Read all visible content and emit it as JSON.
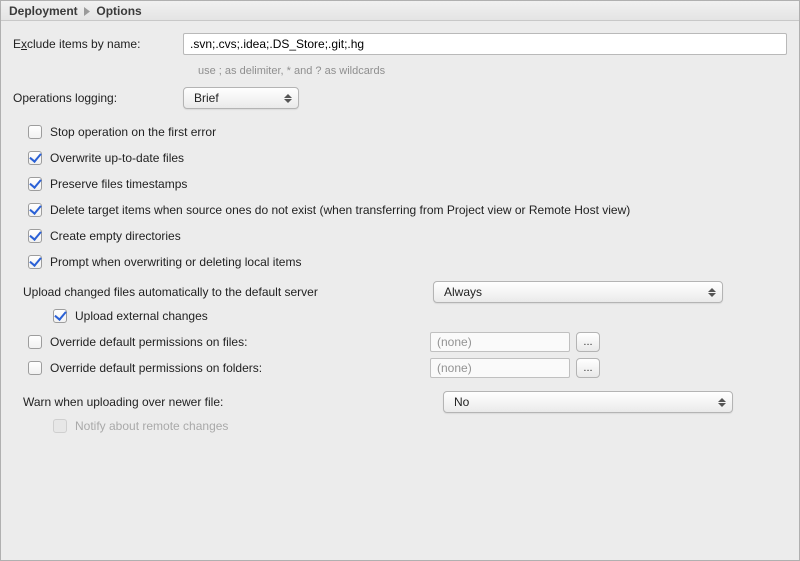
{
  "breadcrumb": {
    "root": "Deployment",
    "leaf": "Options"
  },
  "exclude": {
    "label_pre": "E",
    "label_ul": "x",
    "label_post": "clude items by name:",
    "value": ".svn;.cvs;.idea;.DS_Store;.git;.hg",
    "hint": "use ; as delimiter, * and ? as wildcards"
  },
  "logging": {
    "label": "Operations logging:",
    "value": "Brief"
  },
  "checks": {
    "stop_error": {
      "label": "Stop operation on the first error",
      "checked": false
    },
    "overwrite": {
      "label": "Overwrite up-to-date files",
      "checked": true
    },
    "timestamps": {
      "label": "Preserve files timestamps",
      "checked": true
    },
    "delete_tgt": {
      "label": "Delete target items when source ones do not exist (when transferring from Project view or Remote Host view)",
      "checked": true
    },
    "empty_dirs": {
      "label": "Create empty directories",
      "checked": true
    },
    "prompt": {
      "label": "Prompt when overwriting or deleting local items",
      "checked": true
    }
  },
  "auto_upload": {
    "label": "Upload changed files automatically to the default server",
    "value": "Always"
  },
  "upload_ext": {
    "label": "Upload external changes",
    "checked": true
  },
  "perm_files": {
    "label": "Override default permissions on files:",
    "checked": false,
    "value": "(none)"
  },
  "perm_dirs": {
    "label": "Override default permissions on folders:",
    "checked": false,
    "value": "(none)"
  },
  "warn_newer": {
    "label": "Warn when uploading over newer file:",
    "value": "No"
  },
  "notify_remote": {
    "label": "Notify about remote changes",
    "checked": false,
    "enabled": false
  },
  "icons": {
    "ellipsis": "..."
  }
}
